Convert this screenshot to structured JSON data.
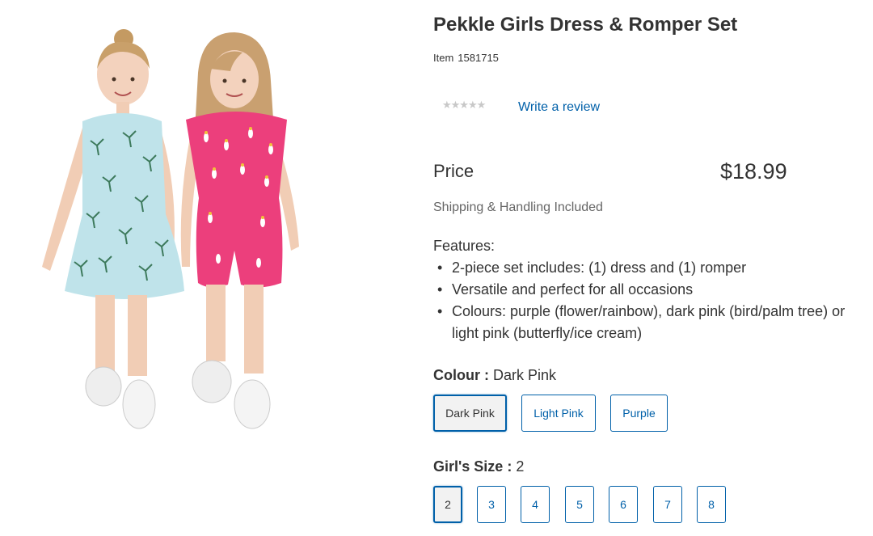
{
  "product": {
    "title": "Pekkle Girls Dress & Romper Set",
    "item_label": "Item",
    "item_number": "1581715",
    "rating_stars": "★★★★★",
    "write_review": "Write a review",
    "image_alt": "two-girls-dress-and-romper-photo"
  },
  "pricing": {
    "label": "Price",
    "value": "$18.99",
    "shipping": "Shipping & Handling Included"
  },
  "features": {
    "title": "Features:",
    "items": [
      "2-piece set includes: (1) dress and (1) romper",
      "Versatile and perfect for all occasions",
      "Colours: purple (flower/rainbow), dark pink (bird/palm tree) or light pink (butterfly/ice cream)"
    ]
  },
  "colour": {
    "label": "Colour :",
    "selected": "Dark Pink",
    "options": [
      "Dark Pink",
      "Light Pink",
      "Purple"
    ]
  },
  "size": {
    "label": "Girl's Size :",
    "selected": "2",
    "options": [
      "2",
      "3",
      "4",
      "5",
      "6",
      "7",
      "8"
    ]
  },
  "colors": {
    "link_blue": "#0060a9",
    "dress_light_blue": "#bfe3ea",
    "romper_pink": "#ec3f7c"
  }
}
